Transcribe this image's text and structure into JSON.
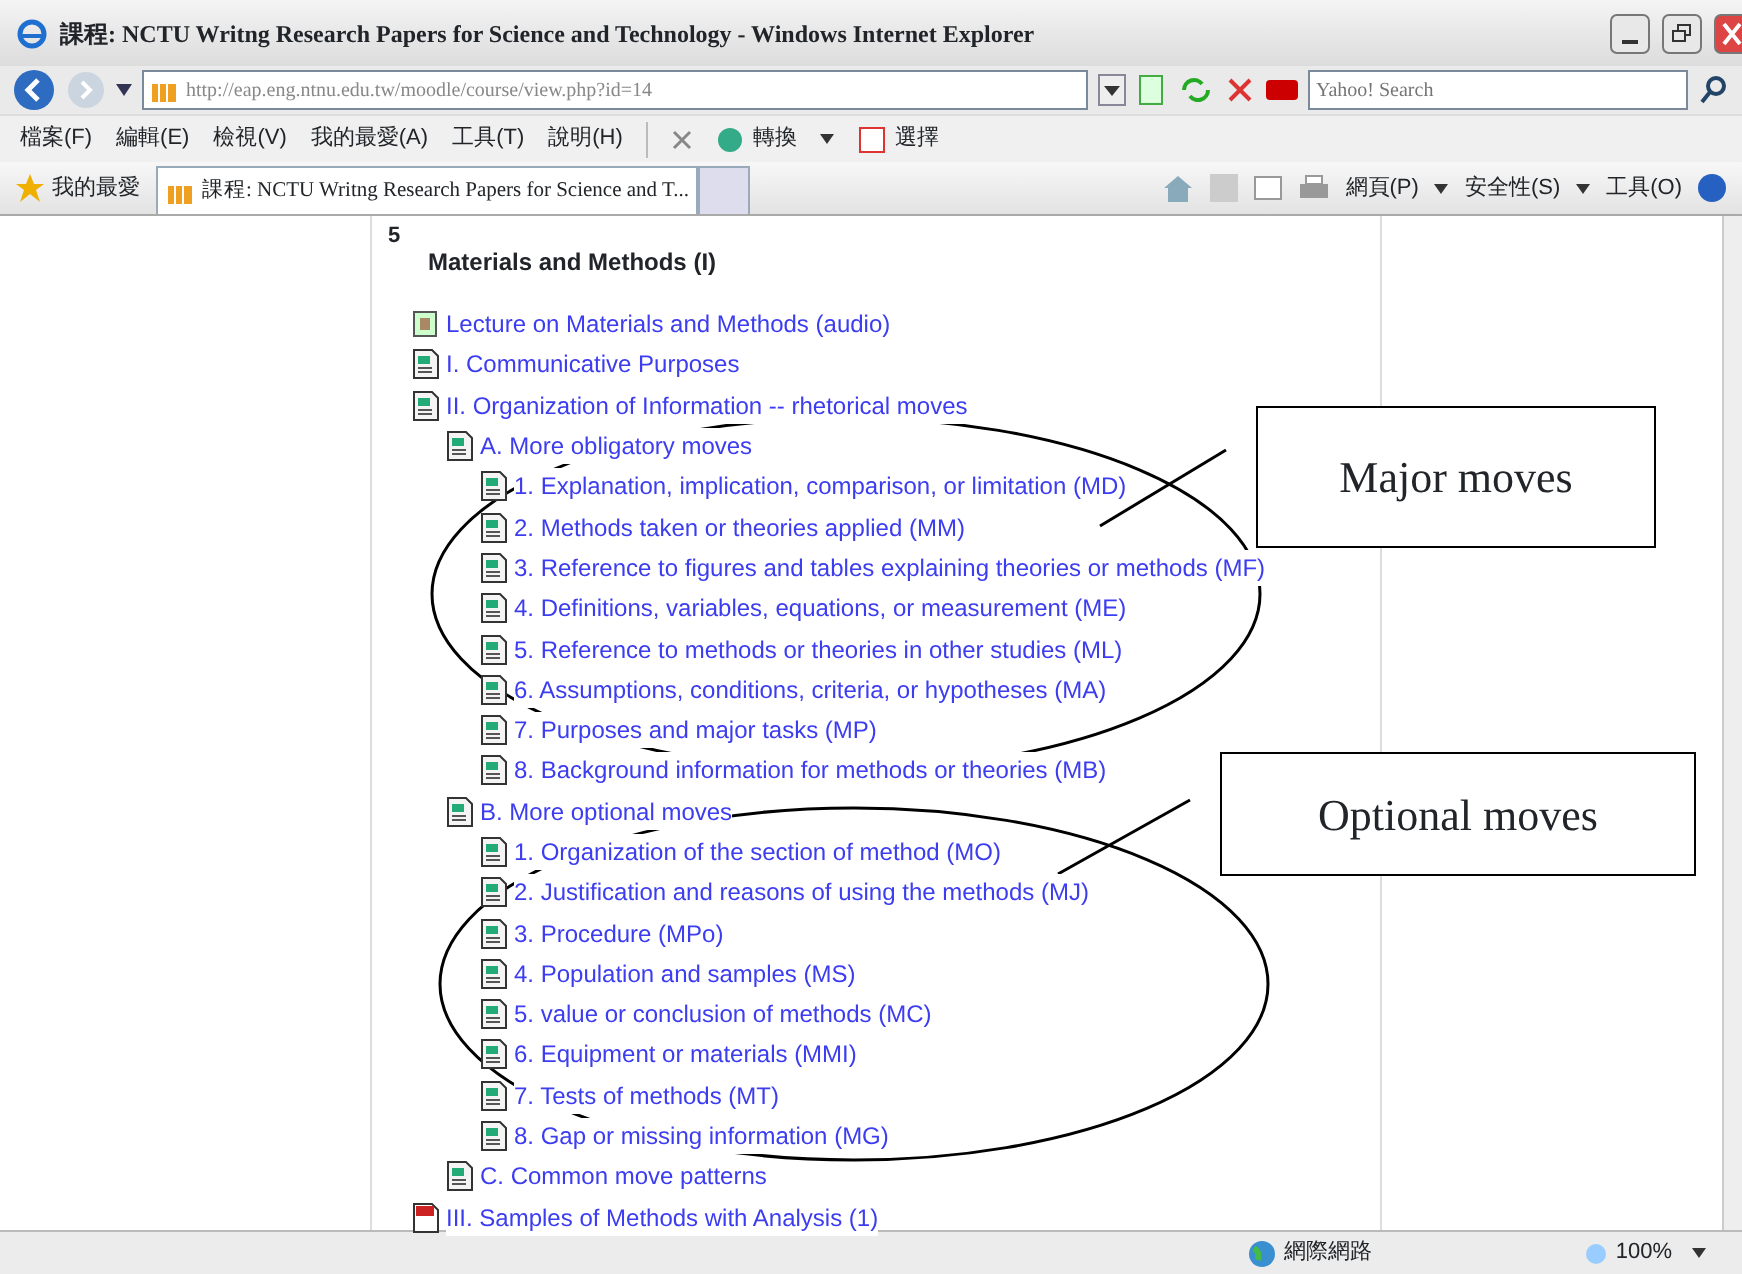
{
  "window": {
    "title": "課程: NCTU Writng Research Papers for Science and Technology - Windows Internet Explorer"
  },
  "address_bar": {
    "url": "http://eap.eng.ntnu.edu.tw/moodle/course/view.php?id=14",
    "search_placeholder": "Yahoo! Search"
  },
  "menu_bar": [
    "檔案(F)",
    "編輯(E)",
    "檢視(V)",
    "我的最愛(A)",
    "工具(T)",
    "說明(H)"
  ],
  "toolbar": [
    "轉換",
    "選擇"
  ],
  "favorites": {
    "label": "我的最愛"
  },
  "tabs": [
    {
      "label": "課程: NCTU Writng Research Papers for Science and T...",
      "selected": true
    }
  ],
  "command_bar": [
    "網頁(P)",
    "安全性(S)",
    "工具(O)"
  ],
  "section": {
    "number": "5",
    "title": "Materials and Methods (I)",
    "items": [
      {
        "kind": "audio",
        "label": "Lecture on Materials and Methods (audio)"
      },
      {
        "kind": "page",
        "label": "I. Communicative Purposes"
      },
      {
        "kind": "page",
        "label": "II. Organization of Information -- rhetorical moves",
        "children": [
          {
            "kind": "page",
            "label": "A. More obligatory moves",
            "children": [
              {
                "kind": "page",
                "label": "1. Explanation, implication, comparison, or limitation (MD)"
              },
              {
                "kind": "page",
                "label": "2. Methods taken or theories applied (MM)"
              },
              {
                "kind": "page",
                "label": "3. Reference to figures and tables explaining theories or methods (MF)"
              },
              {
                "kind": "page",
                "label": "4. Definitions, variables, equations, or measurement (ME)"
              },
              {
                "kind": "page",
                "label": "5. Reference to methods or theories in other studies (ML)"
              },
              {
                "kind": "page",
                "label": "6. Assumptions, conditions, criteria, or hypotheses (MA)"
              },
              {
                "kind": "page",
                "label": "7. Purposes and major tasks (MP)"
              },
              {
                "kind": "page",
                "label": "8. Background information for methods or theories (MB)"
              }
            ]
          },
          {
            "kind": "page",
            "label": "B. More optional moves",
            "children": [
              {
                "kind": "page",
                "label": "1. Organization of the section of method (MO)"
              },
              {
                "kind": "page",
                "label": "2. Justification and reasons of using the methods (MJ)"
              },
              {
                "kind": "page",
                "label": "3. Procedure (MPo)"
              },
              {
                "kind": "page",
                "label": "4. Population and samples (MS)"
              },
              {
                "kind": "page",
                "label": "5. value or conclusion of methods (MC)"
              },
              {
                "kind": "page",
                "label": "6. Equipment or materials (MMI)"
              },
              {
                "kind": "page",
                "label": "7. Tests of methods (MT)"
              },
              {
                "kind": "page",
                "label": "8. Gap or missing information (MG)"
              }
            ]
          },
          {
            "kind": "page",
            "label": "C. Common move patterns"
          }
        ]
      },
      {
        "kind": "pdf",
        "label": "III. Samples of Methods with Analysis (1)"
      }
    ]
  },
  "annotations": [
    {
      "text": "Major moves"
    },
    {
      "text": "Optional moves"
    }
  ],
  "status_bar": {
    "zone": "網際網路",
    "zoom": "100%"
  }
}
